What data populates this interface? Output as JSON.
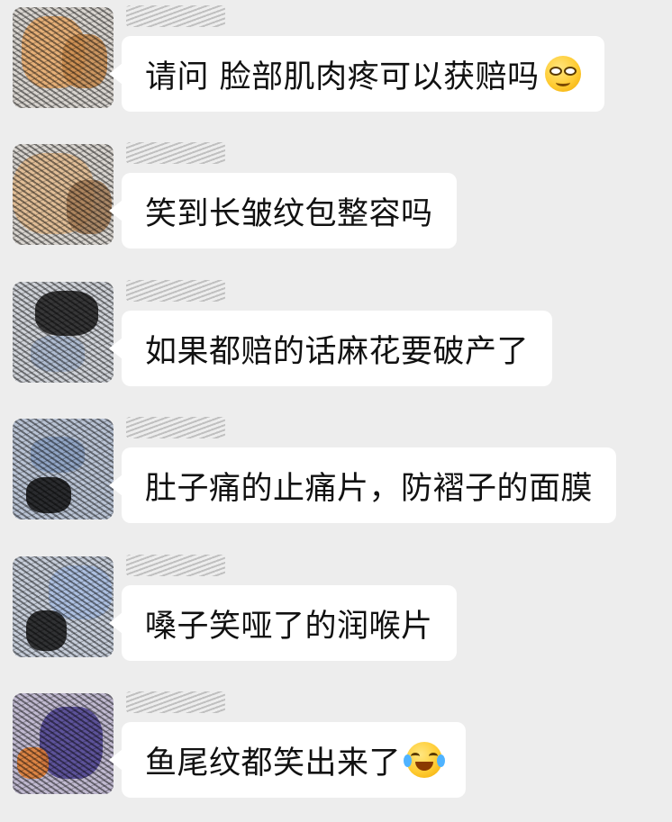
{
  "messages": [
    {
      "text": "请问 脸部肌肉疼可以获赔吗",
      "emoji": "smirk-face-icon"
    },
    {
      "text": "笑到长皱纹包整容吗",
      "emoji": ""
    },
    {
      "text": "如果都赔的话麻花要破产了",
      "emoji": ""
    },
    {
      "text": "肚子痛的止痛片，防褶子的面膜",
      "emoji": ""
    },
    {
      "text": "嗓子笑哑了的润喉片",
      "emoji": ""
    },
    {
      "text": "鱼尾纹都笑出来了",
      "emoji": "tears-of-joy-icon"
    }
  ],
  "colors": {
    "background": "#ededed",
    "bubble": "#ffffff",
    "text": "#111111"
  }
}
